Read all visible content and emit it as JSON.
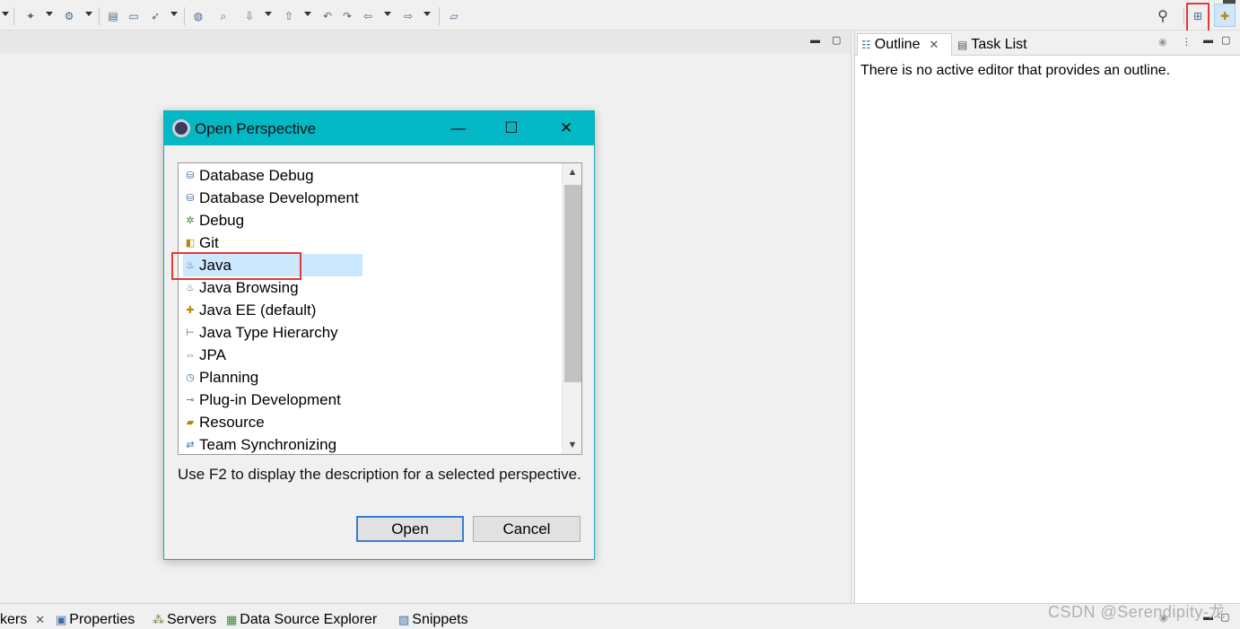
{
  "dialog": {
    "title": "Open Perspective",
    "perspectives": [
      {
        "label": "Database Debug",
        "icon": "db-debug-icon",
        "selected": false
      },
      {
        "label": "Database Development",
        "icon": "db-dev-icon",
        "selected": false
      },
      {
        "label": "Debug",
        "icon": "bug-icon",
        "selected": false
      },
      {
        "label": "Git",
        "icon": "git-icon",
        "selected": false
      },
      {
        "label": "Java",
        "icon": "java-icon",
        "selected": true
      },
      {
        "label": "Java Browsing",
        "icon": "java-browsing-icon",
        "selected": false
      },
      {
        "label": "Java EE (default)",
        "icon": "java-ee-icon",
        "selected": false
      },
      {
        "label": "Java Type Hierarchy",
        "icon": "hierarchy-icon",
        "selected": false
      },
      {
        "label": "JPA",
        "icon": "jpa-icon",
        "selected": false
      },
      {
        "label": "Planning",
        "icon": "planning-icon",
        "selected": false
      },
      {
        "label": "Plug-in Development",
        "icon": "plugin-icon",
        "selected": false
      },
      {
        "label": "Resource",
        "icon": "folder-icon",
        "selected": false
      },
      {
        "label": "Team Synchronizing",
        "icon": "team-sync-icon",
        "selected": false
      }
    ],
    "hint": "Use F2 to display the description for a selected perspective.",
    "open_label": "Open",
    "cancel_label": "Cancel",
    "minimize_glyph": "—",
    "maximize_glyph": "☐",
    "close_glyph": "✕"
  },
  "outline": {
    "tabs": [
      {
        "label": "Outline",
        "close": "✕"
      },
      {
        "label": "Task List"
      }
    ],
    "message": "There is no active editor that provides an outline."
  },
  "bottom_tabs": [
    {
      "label": "kers",
      "close": "✕"
    },
    {
      "label": "Properties"
    },
    {
      "label": "Servers"
    },
    {
      "label": "Data Source Explorer"
    },
    {
      "label": "Snippets"
    }
  ],
  "watermark": "CSDN @Serendipity-龙",
  "colors": {
    "title_bar": "#03b8c4",
    "selection": "#cce8ff",
    "highlight_box": "#e53935"
  }
}
